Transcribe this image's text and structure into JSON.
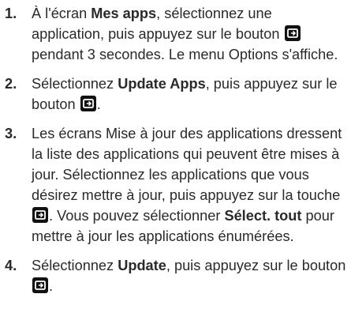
{
  "steps": [
    {
      "number": "1.",
      "parts": [
        "À l'écran ",
        "Mes apps",
        ", sélectionnez une application, puis appuyez sur le bouton ",
        " pendant 3 secondes. Le menu Options s'affiche."
      ]
    },
    {
      "number": "2.",
      "parts": [
        "Sélectionnez ",
        "Update Apps",
        ", puis appuyez sur le bouton ",
        "."
      ]
    },
    {
      "number": "3.",
      "parts": [
        "Les écrans Mise à jour des applications dressent la liste des applications qui peuvent être mises à jour. Sélectionnez les applications que vous désirez mettre à jour, puis appuyez sur la touche ",
        ". Vous pouvez sélectionner ",
        "Sélect. tout",
        " pour mettre à jour les applications énumérées."
      ]
    },
    {
      "number": "4.",
      "parts": [
        "Sélectionnez ",
        "Update",
        ", puis appuyez sur le bouton ",
        "."
      ]
    }
  ],
  "icons": {
    "enter_button": "enter-button-icon"
  }
}
